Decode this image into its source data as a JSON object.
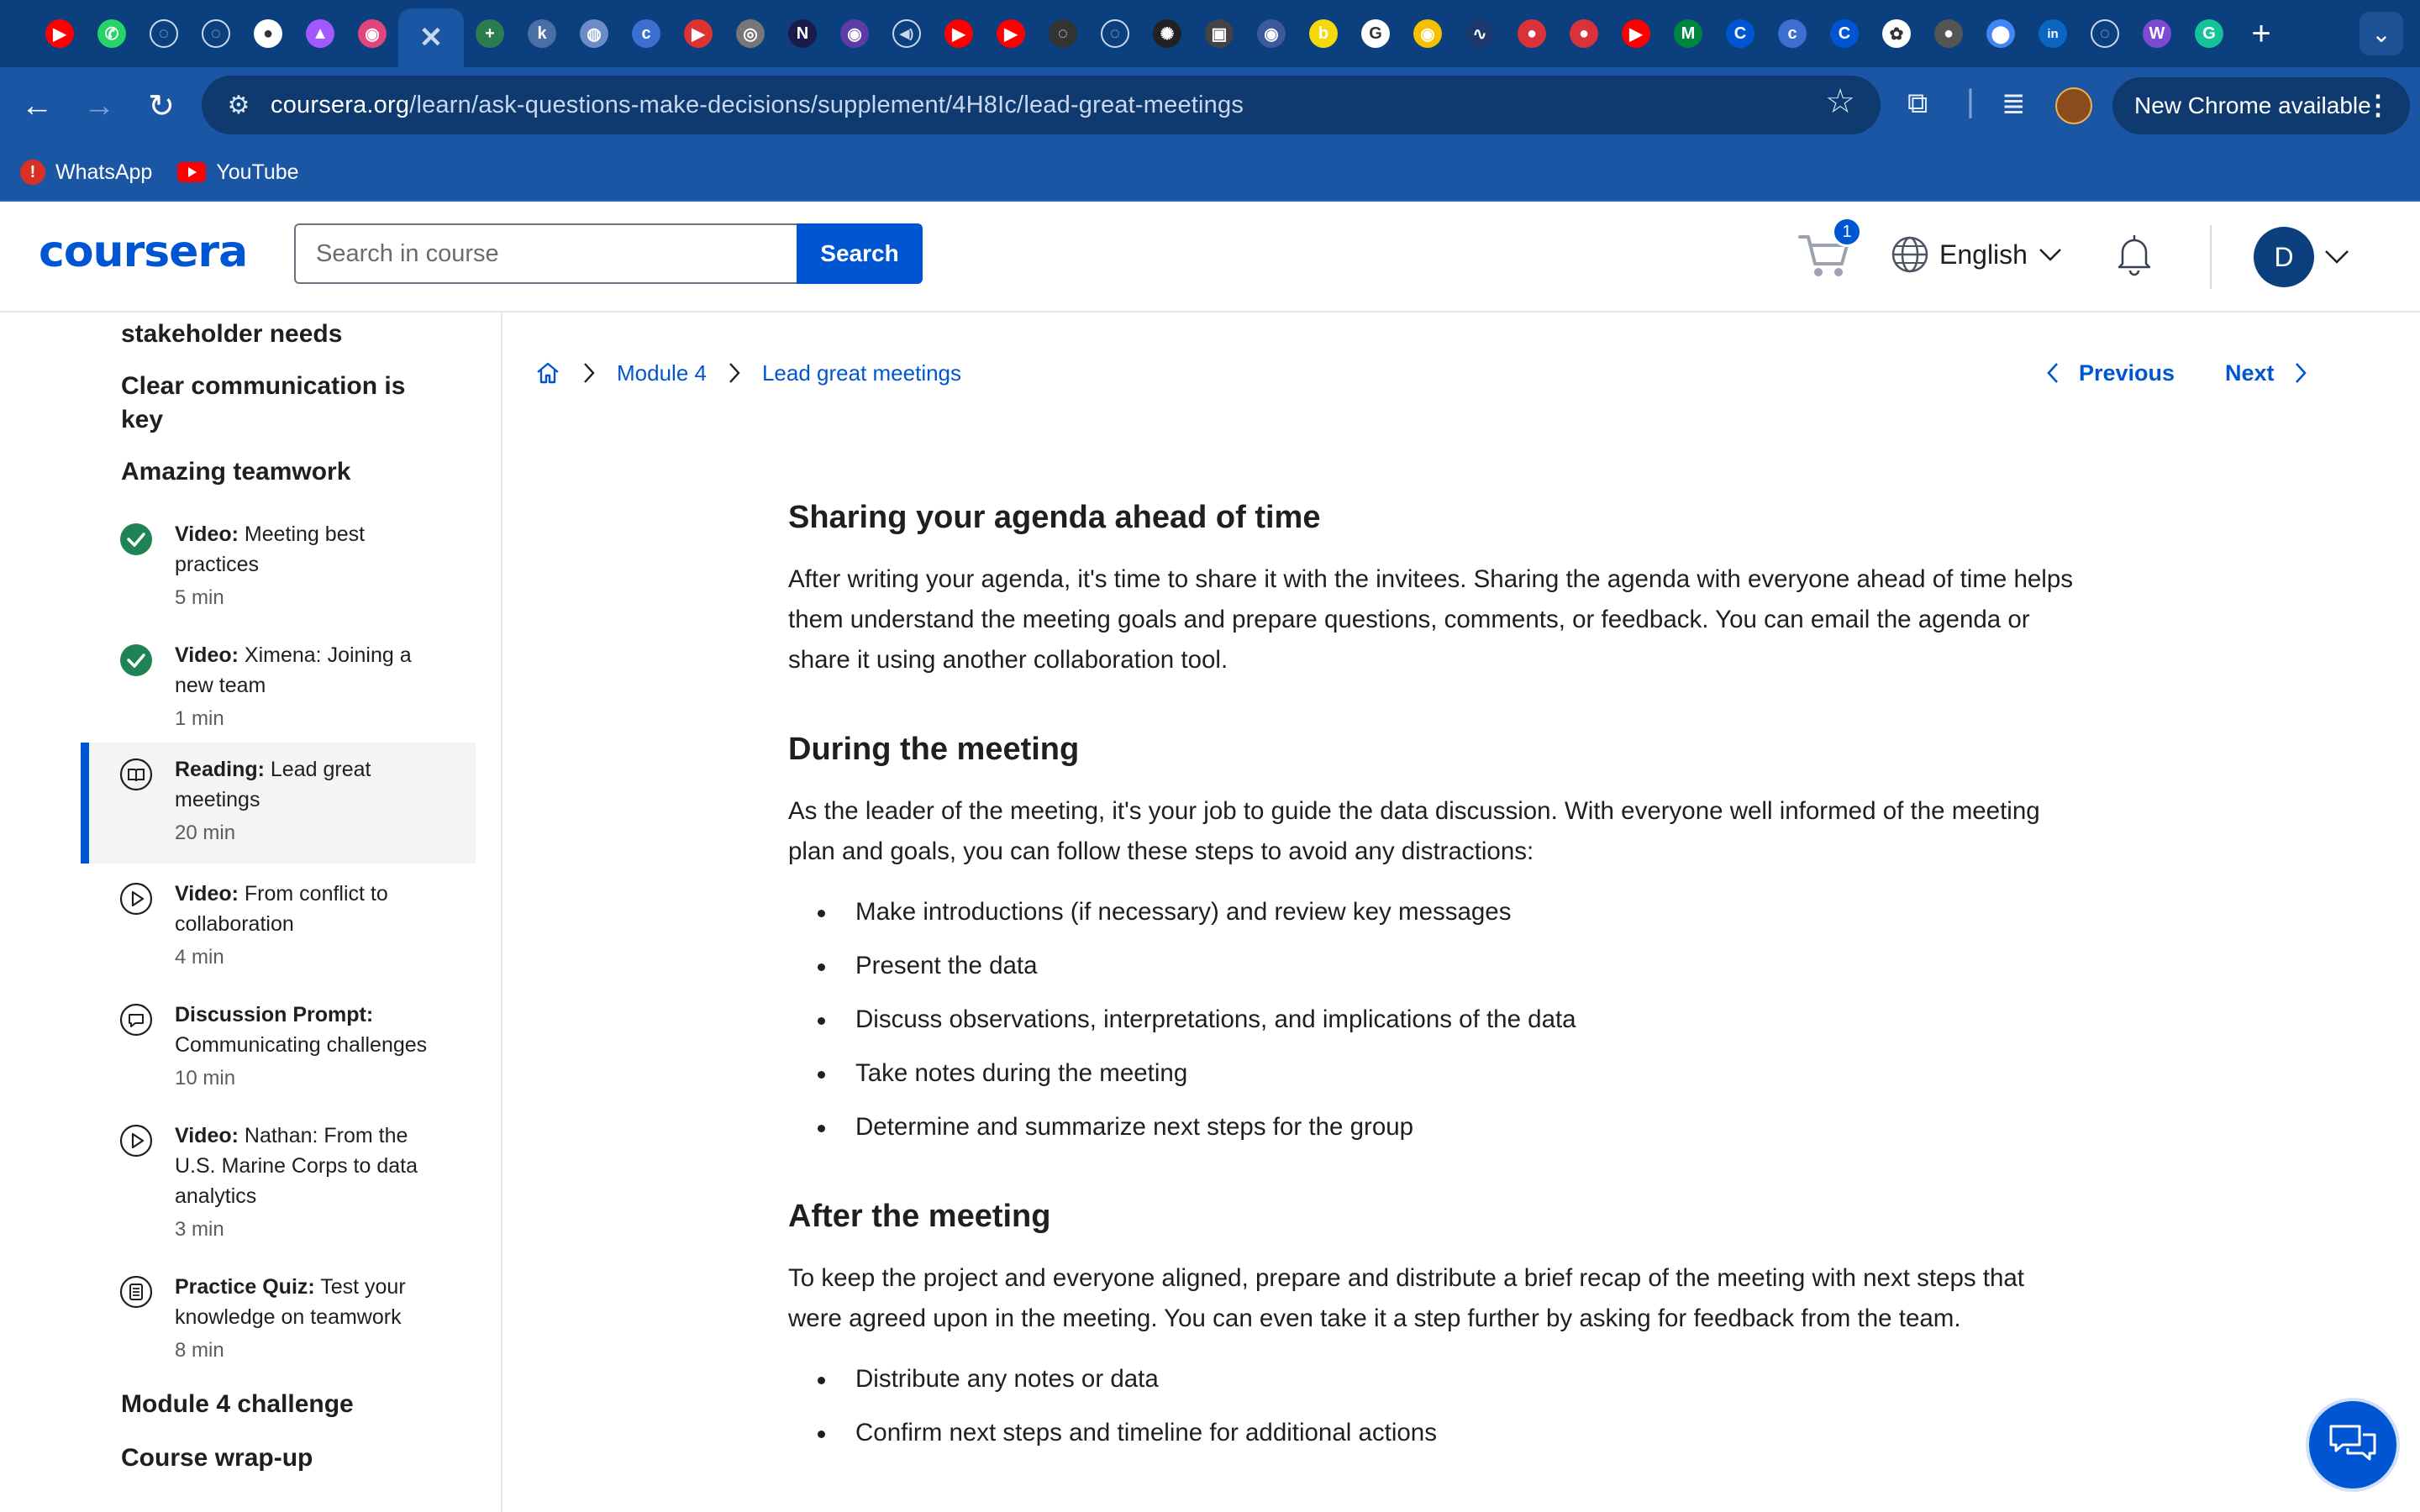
{
  "browser": {
    "tabs": [
      {
        "icon": "youtube-icon",
        "color": "#ff0000",
        "glyph": "▶"
      },
      {
        "icon": "whatsapp-icon",
        "color": "#25d366",
        "glyph": "✆"
      },
      {
        "icon": "loading-icon",
        "color": "transparent",
        "glyph": "◌"
      },
      {
        "icon": "loading-icon",
        "color": "transparent",
        "glyph": "◌"
      },
      {
        "icon": "github-icon",
        "color": "#ffffff",
        "glyph": "●"
      },
      {
        "icon": "slides-icon",
        "color": "#a259ff",
        "glyph": "▲"
      },
      {
        "icon": "app-icon",
        "color": "#e0457b",
        "glyph": "◉"
      },
      {
        "icon": "close-tab-icon",
        "color": "transparent",
        "glyph": "✕",
        "active": true
      },
      {
        "icon": "add-icon",
        "color": "#2a7d4f",
        "glyph": "+"
      },
      {
        "icon": "app-icon",
        "color": "#4a6fa5",
        "glyph": "k"
      },
      {
        "icon": "globe-icon",
        "color": "#6b8cc7",
        "glyph": "◍"
      },
      {
        "icon": "coursera-icon",
        "color": "#3b6fd1",
        "glyph": "c"
      },
      {
        "icon": "youtube-icon",
        "color": "#d33",
        "glyph": "▶"
      },
      {
        "icon": "app-icon",
        "color": "#777",
        "glyph": "◎"
      },
      {
        "icon": "app-icon",
        "color": "#1b1b4b",
        "glyph": "N"
      },
      {
        "icon": "app-icon",
        "color": "#5e3ca8",
        "glyph": "◉"
      },
      {
        "icon": "audio-icon",
        "color": "transparent",
        "glyph": "◀)"
      },
      {
        "icon": "youtube-icon",
        "color": "#ff0000",
        "glyph": "▶"
      },
      {
        "icon": "youtube-icon",
        "color": "#ff0000",
        "glyph": "▶"
      },
      {
        "icon": "app-icon",
        "color": "#333",
        "glyph": "◌"
      },
      {
        "icon": "loading-icon",
        "color": "transparent",
        "glyph": "◌"
      },
      {
        "icon": "app-icon",
        "color": "#222",
        "glyph": "✺"
      },
      {
        "icon": "video-icon",
        "color": "#444",
        "glyph": "▣"
      },
      {
        "icon": "app-icon",
        "color": "#3a5a9a",
        "glyph": "◉"
      },
      {
        "icon": "app-icon",
        "color": "#f5d90a",
        "glyph": "b"
      },
      {
        "icon": "google-icon",
        "color": "#ffffff",
        "glyph": "G"
      },
      {
        "icon": "app-icon",
        "color": "#f5c000",
        "glyph": "◉"
      },
      {
        "icon": "app-icon",
        "color": "#1b3a6b",
        "glyph": "∿"
      },
      {
        "icon": "app-icon",
        "color": "#d9323a",
        "glyph": "●"
      },
      {
        "icon": "app-icon",
        "color": "#d9323a",
        "glyph": "●"
      },
      {
        "icon": "youtube-icon",
        "color": "#ff0000",
        "glyph": "▶"
      },
      {
        "icon": "myunt-icon",
        "color": "#00853e",
        "glyph": "M"
      },
      {
        "icon": "coursera-icon",
        "color": "#0056d2",
        "glyph": "C"
      },
      {
        "icon": "coursera-icon",
        "color": "#3b6fd1",
        "glyph": "c"
      },
      {
        "icon": "coursera-icon",
        "color": "#0056d2",
        "glyph": "C"
      },
      {
        "icon": "openai-icon",
        "color": "#ffffff",
        "glyph": "✿"
      },
      {
        "icon": "github-icon",
        "color": "#555",
        "glyph": "●"
      },
      {
        "icon": "maps-icon",
        "color": "#4285f4",
        "glyph": "⬤"
      },
      {
        "icon": "linkedin-icon",
        "color": "#0a66c2",
        "glyph": "in"
      },
      {
        "icon": "loading-icon",
        "color": "transparent",
        "glyph": "◌"
      },
      {
        "icon": "app-icon",
        "color": "#7b4bd1",
        "glyph": "W"
      },
      {
        "icon": "grammarly-icon",
        "color": "#15c39a",
        "glyph": "G"
      }
    ],
    "url_host": "coursera.org",
    "url_path": "/learn/ask-questions-make-decisions/supplement/4H8Ic/lead-great-meetings",
    "update_label": "New Chrome available",
    "bookmarks": [
      {
        "label": "WhatsApp",
        "icon": "whatsapp-alert-icon"
      },
      {
        "label": "YouTube",
        "icon": "youtube-icon"
      }
    ]
  },
  "header": {
    "logo": "coursera",
    "search_placeholder": "Search in course",
    "search_button": "Search",
    "cart_count": "1",
    "language": "English",
    "avatar_initial": "D"
  },
  "sidebar": {
    "headings": {
      "stakeholder": "stakeholder needs",
      "clear_comm": "Clear communication is key",
      "teamwork": "Amazing teamwork",
      "challenge": "Module 4 challenge",
      "wrapup": "Course wrap-up"
    },
    "items": [
      {
        "type": "Video:",
        "title": "Meeting best practices",
        "duration": "5 min",
        "status": "completed"
      },
      {
        "type": "Video:",
        "title": "Ximena: Joining a new team",
        "duration": "1 min",
        "status": "completed"
      },
      {
        "type": "Reading:",
        "title": "Lead great meetings",
        "duration": "20 min",
        "status": "reading"
      },
      {
        "type": "Video:",
        "title": "From conflict to collaboration",
        "duration": "4 min",
        "status": "video"
      },
      {
        "type": "Discussion Prompt:",
        "title": "Communicating challenges",
        "duration": "10 min",
        "status": "discussion"
      },
      {
        "type": "Video:",
        "title": "Nathan: From the U.S. Marine Corps to data analytics",
        "duration": "3 min",
        "status": "video"
      },
      {
        "type": "Practice Quiz:",
        "title": "Test your knowledge on teamwork",
        "duration": "8 min",
        "status": "quiz"
      }
    ]
  },
  "breadcrumb": {
    "module": "Module 4",
    "page": "Lead great meetings"
  },
  "pager": {
    "previous": "Previous",
    "next": "Next"
  },
  "article": {
    "s1_title": "Sharing your agenda ahead of time",
    "s1_body": "After writing your agenda, it's time to share it with the invitees. Sharing the agenda with everyone ahead of time helps them understand the meeting goals and prepare questions, comments, or feedback. You can email the agenda or share it using another collaboration tool.",
    "s2_title": "During the meeting",
    "s2_body": "As the leader of the meeting, it's your job to guide the data discussion. With everyone well informed of the meeting plan and goals, you can follow these steps to avoid any distractions:",
    "s2_list": [
      "Make introductions (if necessary) and review key messages",
      "Present the data",
      "Discuss observations, interpretations, and implications of the data",
      "Take notes during the meeting",
      "Determine and summarize next steps for the group"
    ],
    "s3_title": "After the meeting",
    "s3_body": "To keep the project and everyone aligned, prepare and distribute a brief recap of the meeting with next steps that were agreed upon in the meeting. You can even take it a step further by asking for feedback from the team.",
    "s3_list": [
      "Distribute any notes or data",
      "Confirm next steps and timeline for additional actions"
    ]
  },
  "colors": {
    "brand": "#0056d2",
    "chrome_dark": "#0b3f7e",
    "chrome": "#1a56a3",
    "completed": "#1f8354"
  }
}
